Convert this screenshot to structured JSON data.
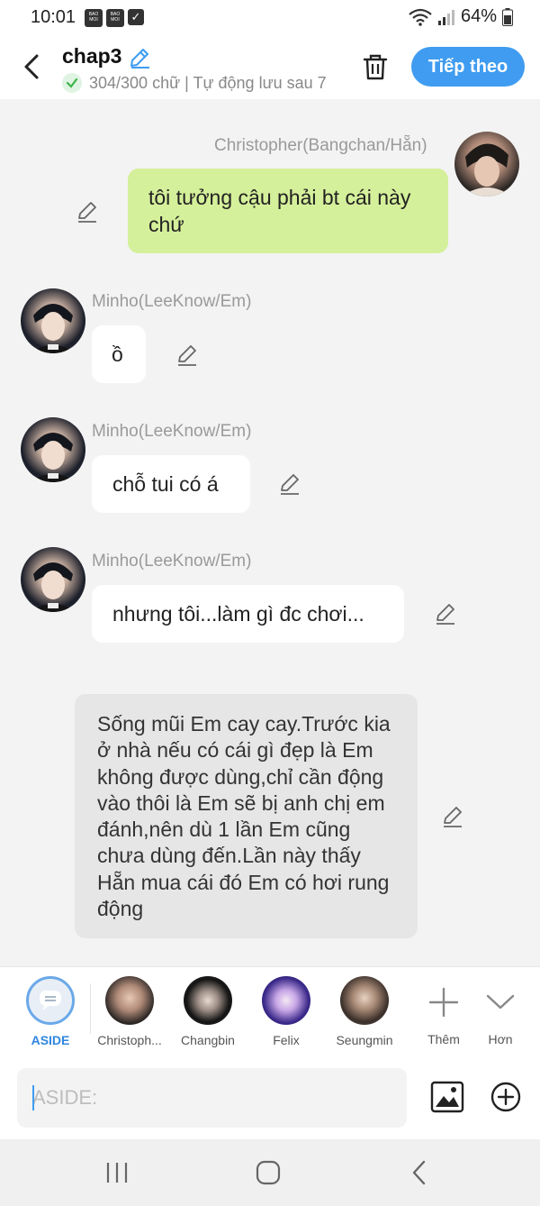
{
  "status_bar": {
    "time": "10:01",
    "badge_text": "BAO MOI",
    "battery": "64%"
  },
  "header": {
    "title": "chap3",
    "subtitle": "304/300 chữ | Tự động lưu sau 7",
    "next_label": "Tiếp theo"
  },
  "messages": [
    {
      "name": "Christopher(Bangchan/Hẵn)",
      "text": "tôi tưởng cậu phải bt cái này chứ"
    },
    {
      "name": "Minho(LeeKnow/Em)",
      "text": "ồ"
    },
    {
      "name": "Minho(LeeKnow/Em)",
      "text": "chỗ tui có á"
    },
    {
      "name": "Minho(LeeKnow/Em)",
      "text": "nhưng tôi...làm gì đc chơi..."
    },
    {
      "name": "",
      "text": "Sống mũi Em cay cay.Trước kia ở nhà nếu có cái gì đẹp là Em không được dùng,chỉ cần động vào thôi là Em sẽ bị anh chị em đánh,nên dù 1 lần Em cũng chưa dùng đến.Lần này thấy Hẵn mua cái đó Em có hơi rung động"
    }
  ],
  "characters": [
    {
      "label": "ASIDE",
      "icon": "aside-icon"
    },
    {
      "label": "Christoph..."
    },
    {
      "label": "Changbin"
    },
    {
      "label": "Felix"
    },
    {
      "label": "Seungmin"
    }
  ],
  "actions": {
    "add_label": "Thêm",
    "more_label": "Hơn"
  },
  "input": {
    "placeholder": "ASIDE:"
  },
  "colors": {
    "accent": "#3f9cf0",
    "my_bubble": "#d5f09a",
    "aside_bubble": "#e6e6e6",
    "check_green": "#3ab54a"
  }
}
